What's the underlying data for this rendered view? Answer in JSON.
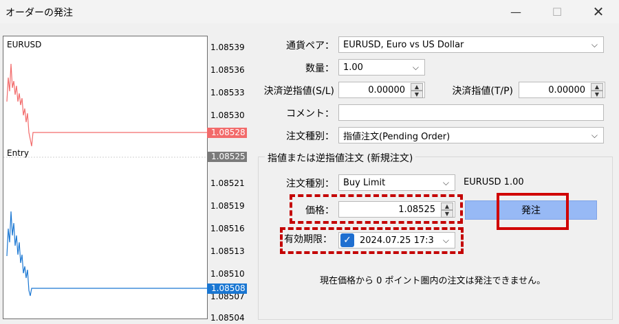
{
  "window": {
    "title": "オーダーの発注",
    "minimize": "—",
    "maximize": "☐",
    "close": "✕"
  },
  "chart": {
    "symbol": "EURUSD",
    "entry_label": "Entry",
    "price_ticks": [
      "1.08539",
      "1.08536",
      "1.08533",
      "1.08530",
      "1.08521",
      "1.08519",
      "1.08516",
      "1.08513",
      "1.08510",
      "1.08507",
      "1.08504"
    ],
    "bid_tag": "1.08528",
    "entry_tag": "1.08525",
    "ask_tag": "1.08508",
    "colors": {
      "bid": "#f26a6a",
      "entry": "#7a7a7a",
      "ask": "#1976d2"
    }
  },
  "form": {
    "symbol_label": "通貨ペア：",
    "symbol_value": "EURUSD, Euro vs US Dollar",
    "volume_label": "数量：",
    "volume_value": "1.00",
    "sl_label": "決済逆指値(S/L)",
    "sl_value": "0.00000",
    "tp_label": "決済指値(T/P)",
    "tp_value": "0.00000",
    "comment_label": "コメント：",
    "comment_value": "",
    "type_label": "注文種別：",
    "type_value": "指値注文(Pending Order)"
  },
  "pending": {
    "group_title": "指値または逆指値注文 (新規注文)",
    "type_label": "注文種別：",
    "type_value": "Buy Limit",
    "symbol_info": "EURUSD 1.00",
    "price_label": "価格：",
    "price_value": "1.08525",
    "expiry_label": "有効期限：",
    "expiry_value": "2024.07.25 17:3",
    "order_button": "発注",
    "notice": "現在価格から 0 ポイント圏内の注文は発注できません。"
  },
  "icons": {
    "check": "✓",
    "chevron": "⌵",
    "up": "▲",
    "down": "▼"
  }
}
